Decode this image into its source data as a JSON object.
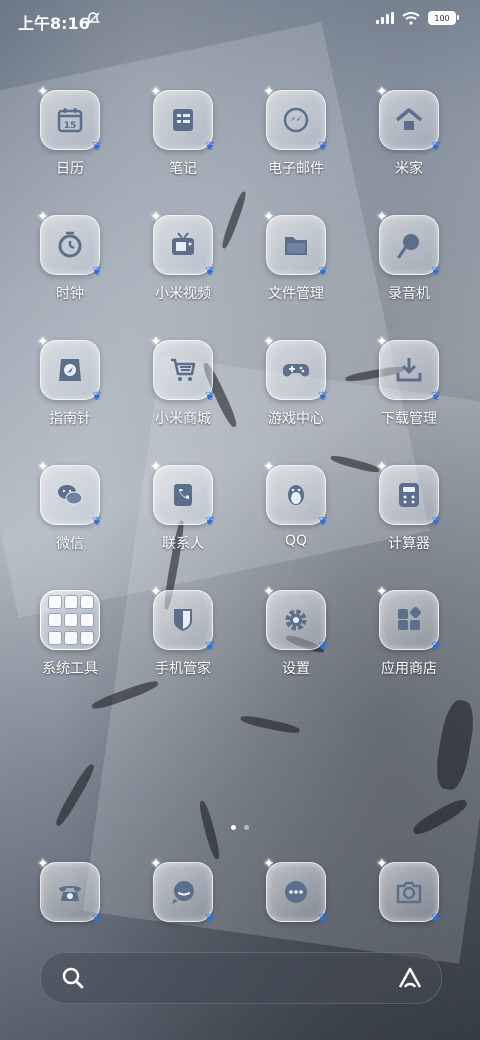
{
  "status_bar": {
    "time": "上午8:16",
    "battery": "100"
  },
  "apps": [
    {
      "label": "日历",
      "icon": "calendar-icon",
      "day": "15"
    },
    {
      "label": "笔记",
      "icon": "notes-icon"
    },
    {
      "label": "电子邮件",
      "icon": "email-icon"
    },
    {
      "label": "米家",
      "icon": "home-icon"
    },
    {
      "label": "时钟",
      "icon": "clock-icon"
    },
    {
      "label": "小米视频",
      "icon": "tv-icon"
    },
    {
      "label": "文件管理",
      "icon": "folder-icon"
    },
    {
      "label": "录音机",
      "icon": "recorder-icon"
    },
    {
      "label": "指南针",
      "icon": "compass-icon"
    },
    {
      "label": "小米商城",
      "icon": "cart-icon"
    },
    {
      "label": "游戏中心",
      "icon": "gamepad-icon"
    },
    {
      "label": "下载管理",
      "icon": "download-icon"
    },
    {
      "label": "微信",
      "icon": "wechat-icon"
    },
    {
      "label": "联系人",
      "icon": "contacts-icon"
    },
    {
      "label": "QQ",
      "icon": "penguin-icon"
    },
    {
      "label": "计算器",
      "icon": "calculator-icon"
    },
    {
      "label": "系统工具",
      "icon": "folder-grid-icon"
    },
    {
      "label": "手机管家",
      "icon": "shield-icon"
    },
    {
      "label": "设置",
      "icon": "gear-icon"
    },
    {
      "label": "应用商店",
      "icon": "app-store-icon"
    }
  ],
  "dock": [
    {
      "icon": "phone-icon"
    },
    {
      "icon": "message-icon"
    },
    {
      "icon": "chat-bubble-icon"
    },
    {
      "icon": "camera-icon"
    }
  ],
  "page_indicator": {
    "pages": 2,
    "current": 1
  },
  "search": {
    "icon": "search-icon",
    "assistant_icon": "assistant-icon"
  },
  "colors": {
    "accent": "#2f6fdc",
    "icon_glyph": "#5b6f8a"
  }
}
